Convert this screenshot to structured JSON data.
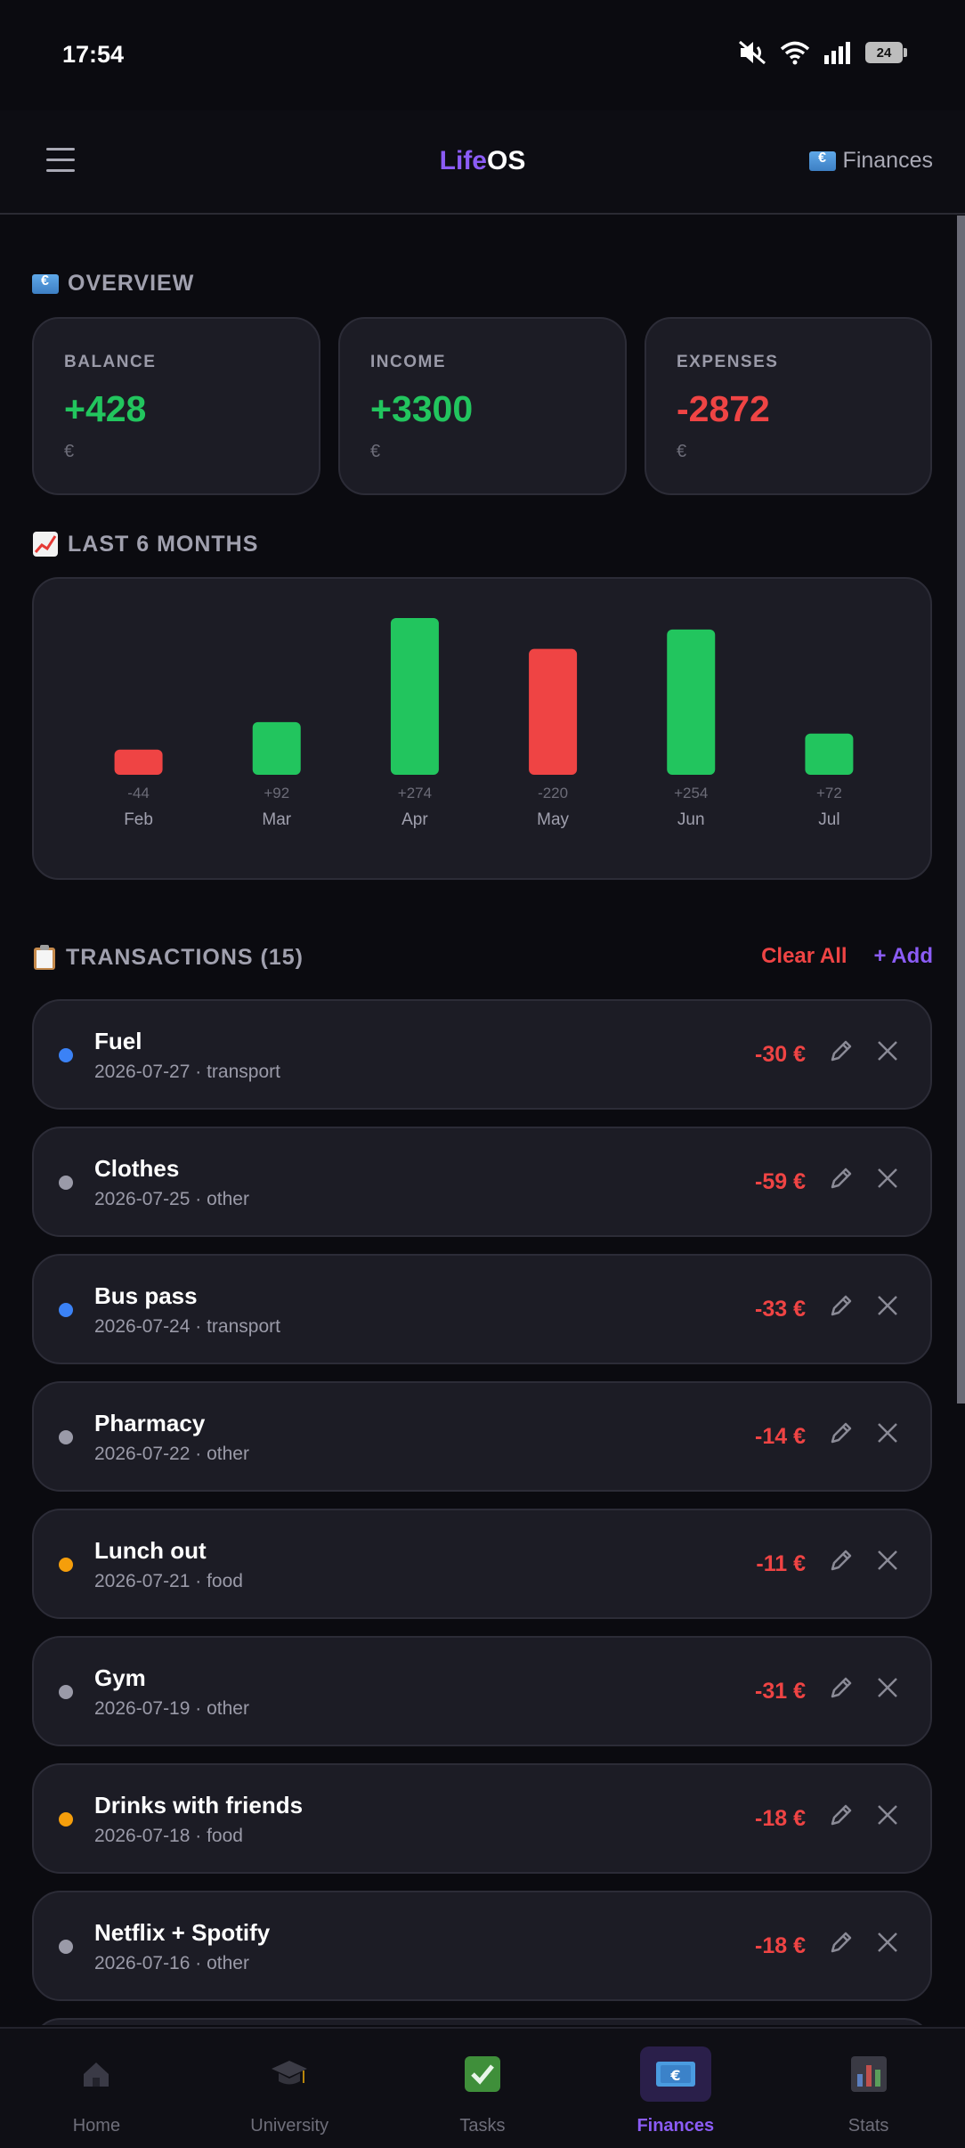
{
  "status": {
    "time": "17:54",
    "battery": "24"
  },
  "header": {
    "title_part1": "Life",
    "title_part2": "OS",
    "section_label": "Finances",
    "section_icon": "money-emoji-icon"
  },
  "overview": {
    "title": "OVERVIEW",
    "cards": [
      {
        "label": "BALANCE",
        "value": "+428",
        "unit": "€",
        "tone": "positive"
      },
      {
        "label": "INCOME",
        "value": "+3300",
        "unit": "€",
        "tone": "positive"
      },
      {
        "label": "EXPENSES",
        "value": "-2872",
        "unit": "€",
        "tone": "negative"
      }
    ]
  },
  "chart_section": {
    "title": "LAST 6 MONTHS"
  },
  "chart_data": {
    "type": "bar",
    "categories": [
      "Feb",
      "Mar",
      "Apr",
      "May",
      "Jun",
      "Jul"
    ],
    "values": [
      -44,
      92,
      274,
      -220,
      254,
      72
    ],
    "value_labels": [
      "-44",
      "+92",
      "+274",
      "-220",
      "+254",
      "+72"
    ],
    "colors": {
      "positive": "#22c55e",
      "negative": "#ef4444"
    }
  },
  "transactions": {
    "title": "TRANSACTIONS (15)",
    "clear_label": "Clear All",
    "add_label": "+ Add",
    "items": [
      {
        "title": "Fuel",
        "subtitle": "2026-07-27 · transport",
        "amount": "-30 €",
        "dot": "#3b82f6"
      },
      {
        "title": "Clothes",
        "subtitle": "2026-07-25 · other",
        "amount": "-59 €",
        "dot": "#9a9aa8"
      },
      {
        "title": "Bus pass",
        "subtitle": "2026-07-24 · transport",
        "amount": "-33 €",
        "dot": "#3b82f6"
      },
      {
        "title": "Pharmacy",
        "subtitle": "2026-07-22 · other",
        "amount": "-14 €",
        "dot": "#9a9aa8"
      },
      {
        "title": "Lunch out",
        "subtitle": "2026-07-21 · food",
        "amount": "-11 €",
        "dot": "#f59e0b"
      },
      {
        "title": "Gym",
        "subtitle": "2026-07-19 · other",
        "amount": "-31 €",
        "dot": "#9a9aa8"
      },
      {
        "title": "Drinks with friends",
        "subtitle": "2026-07-18 · food",
        "amount": "-18 €",
        "dot": "#f59e0b"
      },
      {
        "title": "Netflix + Spotify",
        "subtitle": "2026-07-16 · other",
        "amount": "-18 €",
        "dot": "#9a9aa8"
      }
    ]
  },
  "nav": {
    "items": [
      {
        "label": "Home",
        "icon": "home-icon",
        "active": false
      },
      {
        "label": "University",
        "icon": "graduation-cap-icon",
        "active": false
      },
      {
        "label": "Tasks",
        "icon": "check-mark-icon",
        "active": false
      },
      {
        "label": "Finances",
        "icon": "money-emoji-icon",
        "active": true
      },
      {
        "label": "Stats",
        "icon": "bar-chart-icon",
        "active": false
      }
    ]
  }
}
